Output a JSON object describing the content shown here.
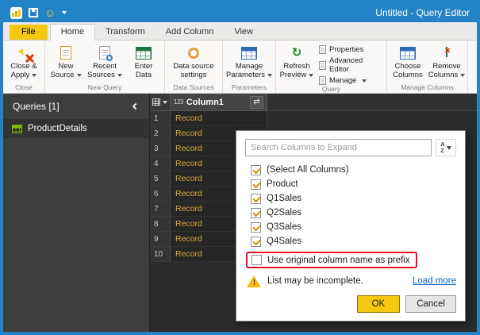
{
  "titlebar": {
    "title": "Untitled - Query Editor"
  },
  "tabs": {
    "file": "File",
    "home": "Home",
    "transform": "Transform",
    "add_column": "Add Column",
    "view": "View"
  },
  "ribbon": {
    "buttons": {
      "close_apply": {
        "l1": "Close &",
        "l2": "Apply"
      },
      "new_source": {
        "l1": "New",
        "l2": "Source"
      },
      "recent_sources": {
        "l1": "Recent",
        "l2": "Sources"
      },
      "enter_data": {
        "l1": "Enter",
        "l2": "Data"
      },
      "data_source_settings": {
        "l1": "Data source",
        "l2": "settings"
      },
      "manage_parameters": {
        "l1": "Manage",
        "l2": "Parameters"
      },
      "refresh_preview": {
        "l1": "Refresh",
        "l2": "Preview"
      },
      "properties": "Properties",
      "advanced_editor": "Advanced Editor",
      "manage": "Manage",
      "choose_columns": {
        "l1": "Choose",
        "l2": "Columns"
      },
      "remove_columns": {
        "l1": "Remove",
        "l2": "Columns"
      }
    },
    "groups": {
      "close": "Close",
      "new_query": "New Query",
      "data_sources": "Data Sources",
      "parameters": "Parameters",
      "query": "Query",
      "manage_columns": "Manage Columns"
    }
  },
  "sidebar": {
    "header": "Queries [1]",
    "items": [
      {
        "label": "ProductDetails"
      }
    ]
  },
  "grid": {
    "type_indicator": "123",
    "column_header": "Column1",
    "rows": [
      {
        "n": "1",
        "value": "Record"
      },
      {
        "n": "2",
        "value": "Record"
      },
      {
        "n": "3",
        "value": "Record"
      },
      {
        "n": "4",
        "value": "Record"
      },
      {
        "n": "5",
        "value": "Record"
      },
      {
        "n": "6",
        "value": "Record"
      },
      {
        "n": "7",
        "value": "Record"
      },
      {
        "n": "8",
        "value": "Record"
      },
      {
        "n": "9",
        "value": "Record"
      },
      {
        "n": "10",
        "value": "Record"
      }
    ]
  },
  "popup": {
    "search_placeholder": "Search Columns to Expand",
    "columns": [
      {
        "label": "(Select All Columns)",
        "checked": true
      },
      {
        "label": "Product",
        "checked": true
      },
      {
        "label": "Q1Sales",
        "checked": true
      },
      {
        "label": "Q2Sales",
        "checked": true
      },
      {
        "label": "Q3Sales",
        "checked": true
      },
      {
        "label": "Q4Sales",
        "checked": true
      }
    ],
    "prefix_option": "Use original column name as prefix",
    "prefix_checked": false,
    "warning_text": "List may be incomplete.",
    "load_more": "Load more",
    "ok": "OK",
    "cancel": "Cancel"
  },
  "icons": {
    "smiley": "☺",
    "refresh": "↻",
    "expand": "⇄",
    "sort_a": "A",
    "sort_z": "Z",
    "warning_mark": "!"
  },
  "colors": {
    "titlebar": "#2383c6",
    "accent": "#f2c811",
    "record_link": "#d9a83c",
    "annotation": "#e8112d"
  }
}
